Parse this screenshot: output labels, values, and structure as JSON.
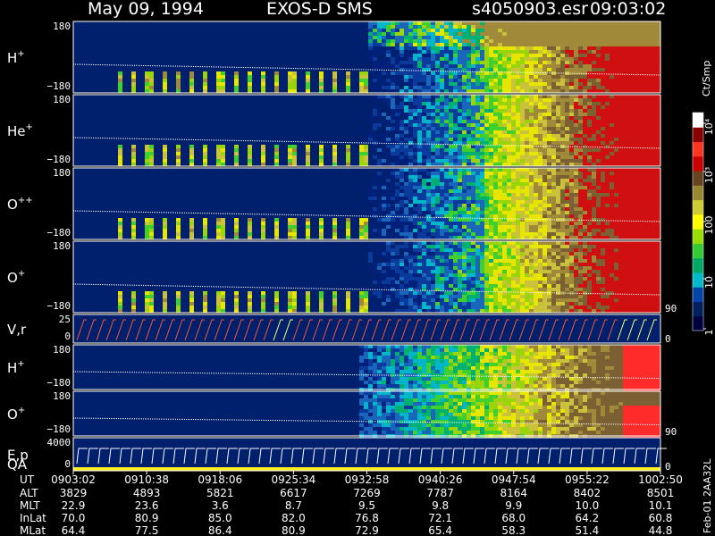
{
  "header": {
    "date": "May 09, 1994",
    "instrument": "EXOS-D SMS",
    "file": "s4050903.esr",
    "time": "09:03:02"
  },
  "colorbar": {
    "unit": "Ct/Smp",
    "ticks": [
      "1",
      "10",
      "100",
      "10³",
      "10⁴"
    ],
    "stops": [
      "#000040",
      "#002060",
      "#0044aa",
      "#00bbcc",
      "#00aa66",
      "#33cc33",
      "#99dd00",
      "#ffff00",
      "#cccc33",
      "#998833",
      "#664422",
      "#cc0000",
      "#ff3322",
      "#880000",
      "#ffffff"
    ]
  },
  "chart_data": {
    "type": "heatmap",
    "panels": [
      {
        "id": "h-plus",
        "label": "H",
        "sup": "+",
        "ytop": "180",
        "ybot": "−180",
        "right": ""
      },
      {
        "id": "he-plus",
        "label": "He",
        "sup": "+",
        "ytop": "180",
        "ybot": "−180",
        "right": ""
      },
      {
        "id": "o-plusplus",
        "label": "O",
        "sup": "++",
        "ytop": "180",
        "ybot": "−180",
        "right": ""
      },
      {
        "id": "o-plus",
        "label": "O",
        "sup": "+",
        "ytop": "180",
        "ybot": "−180",
        "right": "90"
      },
      {
        "id": "vr",
        "label": "V,r",
        "sup": "",
        "ytop": "25",
        "ybot": "0",
        "right": "0"
      },
      {
        "id": "h-plus-2",
        "label": "H",
        "sup": "+",
        "ytop": "180",
        "ybot": "−180",
        "right": ""
      },
      {
        "id": "o-plus-2",
        "label": "O",
        "sup": "+",
        "ytop": "180",
        "ybot": "−180",
        "right": "90"
      },
      {
        "id": "ep-qa",
        "label": "E,p",
        "label2": "QA",
        "sup": "",
        "ytop": "4000",
        "ybot": "0",
        "right": "0"
      }
    ],
    "time_axis": {
      "row_labels": [
        "UT",
        "ALT",
        "MLT",
        "InLat",
        "MLat"
      ],
      "columns": [
        {
          "UT": "0903:02",
          "ALT": "3829",
          "MLT": "22.9",
          "InLat": "70.0",
          "MLat": "64.4"
        },
        {
          "UT": "0910:38",
          "ALT": "4893",
          "MLT": "23.6",
          "InLat": "80.9",
          "MLat": "77.5"
        },
        {
          "UT": "0918:06",
          "ALT": "5821",
          "MLT": "3.6",
          "InLat": "85.0",
          "MLat": "86.4"
        },
        {
          "UT": "0925:34",
          "ALT": "6617",
          "MLT": "8.7",
          "InLat": "82.0",
          "MLat": "80.9"
        },
        {
          "UT": "0932:58",
          "ALT": "7269",
          "MLT": "9.5",
          "InLat": "76.8",
          "MLat": "72.9"
        },
        {
          "UT": "0940:26",
          "ALT": "7787",
          "MLT": "9.8",
          "InLat": "72.1",
          "MLat": "65.4"
        },
        {
          "UT": "0947:54",
          "ALT": "8164",
          "MLT": "9.9",
          "InLat": "68.0",
          "MLat": "58.3"
        },
        {
          "UT": "0955:22",
          "ALT": "8402",
          "MLT": "10.0",
          "InLat": "64.2",
          "MLat": "51.4"
        },
        {
          "UT": "1002:50",
          "ALT": "8501",
          "MLT": "10.1",
          "InLat": "60.8",
          "MLat": "44.8"
        }
      ]
    }
  },
  "footer": {
    "tag": "Feb-01  2AA32L"
  }
}
